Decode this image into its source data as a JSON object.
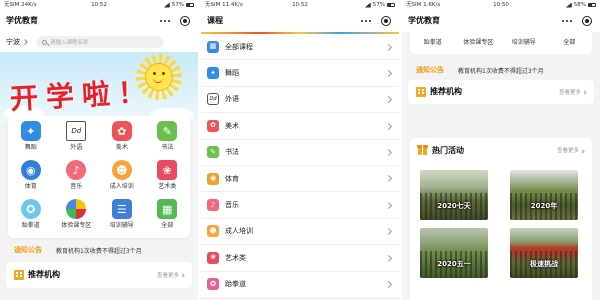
{
  "colors": {
    "page_bg": "#f3f3f3",
    "accent_orange": "#f5a623",
    "notice_orange": "#f39c12",
    "banner_text_red": "#e8202a",
    "banner_sky": "#c7e9f6"
  },
  "home": {
    "status": {
      "carrier": "无SIM 24K/s",
      "time": "10:52",
      "battery": "57%"
    },
    "app_title": "学优教育",
    "location": "宁波",
    "search_placeholder": "请输入课程名称",
    "banner_text": "开学啦！",
    "categories": [
      {
        "label": "舞蹈",
        "icon": "dance-icon"
      },
      {
        "label": "外语",
        "icon": "foreign-language-icon",
        "glyph": "Dd"
      },
      {
        "label": "美术",
        "icon": "palette-icon"
      },
      {
        "label": "书法",
        "icon": "brush-icon"
      },
      {
        "label": "体育",
        "icon": "sports-icon"
      },
      {
        "label": "音乐",
        "icon": "music-icon"
      },
      {
        "label": "成人培训",
        "icon": "adult-training-icon"
      },
      {
        "label": "艺术类",
        "icon": "arts-icon"
      },
      {
        "label": "跆拳道",
        "icon": "taekwondo-icon"
      },
      {
        "label": "体验课专区",
        "icon": "trial-class-icon"
      },
      {
        "label": "培训辅导",
        "icon": "tutoring-icon"
      },
      {
        "label": "全部",
        "icon": "all-grid-icon"
      }
    ],
    "notice": {
      "label": "通知公告",
      "text": "教育机构1次收费不得超过3个月"
    },
    "recommended": {
      "title": "推荐机构",
      "more": "查看更多"
    }
  },
  "courses": {
    "status": {
      "carrier": "无SIM 11.4K/s",
      "time": "10:52",
      "battery": "57%"
    },
    "title": "课程",
    "items": [
      {
        "label": "全部课程",
        "icon": "all-courses-icon"
      },
      {
        "label": "舞蹈",
        "icon": "dance-icon"
      },
      {
        "label": "外语",
        "icon": "foreign-language-icon",
        "glyph": "Dd"
      },
      {
        "label": "美术",
        "icon": "palette-icon"
      },
      {
        "label": "书法",
        "icon": "brush-icon"
      },
      {
        "label": "体育",
        "icon": "sports-icon"
      },
      {
        "label": "音乐",
        "icon": "music-icon"
      },
      {
        "label": "成人培训",
        "icon": "adult-training-icon"
      },
      {
        "label": "艺术类",
        "icon": "arts-icon"
      },
      {
        "label": "跆拳道",
        "icon": "taekwondo-icon"
      }
    ]
  },
  "home_scrolled": {
    "status": {
      "carrier": "无SIM 1.6K/s",
      "time": "10:50",
      "battery": "58%"
    },
    "app_title": "学优教育",
    "category_labels": [
      "跆拳道",
      "体验课专区",
      "培训辅导",
      "全部"
    ],
    "notice": {
      "label": "通知公告",
      "text": "教育机构1次收费不得超过3个月"
    },
    "recommended": {
      "title": "推荐机构",
      "more": "查看更多"
    },
    "activities": {
      "title": "热门活动",
      "more": "查看更多",
      "photos": [
        {
          "caption": "2020七天"
        },
        {
          "caption": "2020年"
        },
        {
          "caption": "2020五一"
        },
        {
          "caption": "极速挑战"
        }
      ]
    }
  }
}
